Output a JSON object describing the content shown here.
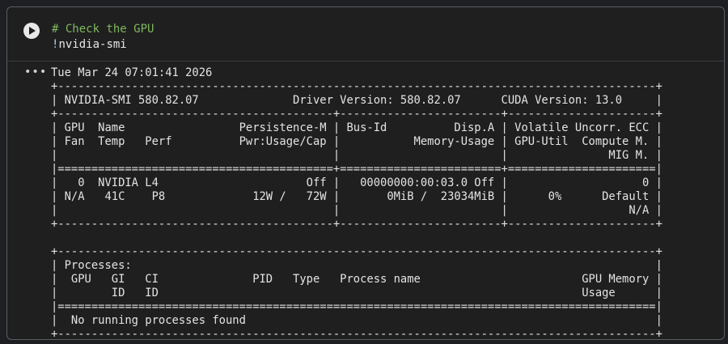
{
  "cell": {
    "run_icon": "play-icon",
    "code_lines": {
      "comment": "# Check the GPU",
      "bang": "!",
      "command": "nvidia-smi"
    },
    "output_menu_icon": "ellipsis-icon",
    "output_lines": [
      "Tue Mar 24 07:01:41 2026",
      "+-----------------------------------------------------------------------------------------+",
      "| NVIDIA-SMI 580.82.07              Driver Version: 580.82.07      CUDA Version: 13.0     |",
      "+-----------------------------------------+------------------------+----------------------+",
      "| GPU  Name                 Persistence-M | Bus-Id          Disp.A | Volatile Uncorr. ECC |",
      "| Fan  Temp   Perf          Pwr:Usage/Cap |           Memory-Usage | GPU-Util  Compute M. |",
      "|                                         |                        |               MIG M. |",
      "|=========================================+========================+======================|",
      "|   0  NVIDIA L4                      Off |   00000000:00:03.0 Off |                    0 |",
      "| N/A   41C    P8             12W /   72W |       0MiB /  23034MiB |      0%      Default |",
      "|                                         |                        |                  N/A |",
      "+-----------------------------------------+------------------------+----------------------+",
      "",
      "+-----------------------------------------------------------------------------------------+",
      "| Processes:                                                                              |",
      "|  GPU   GI   CI              PID   Type   Process name                        GPU Memory |",
      "|        ID   ID                                                               Usage      |",
      "|=========================================================================================|",
      "|  No running processes found                                                             |",
      "+-----------------------------------------------------------------------------------------+"
    ]
  }
}
